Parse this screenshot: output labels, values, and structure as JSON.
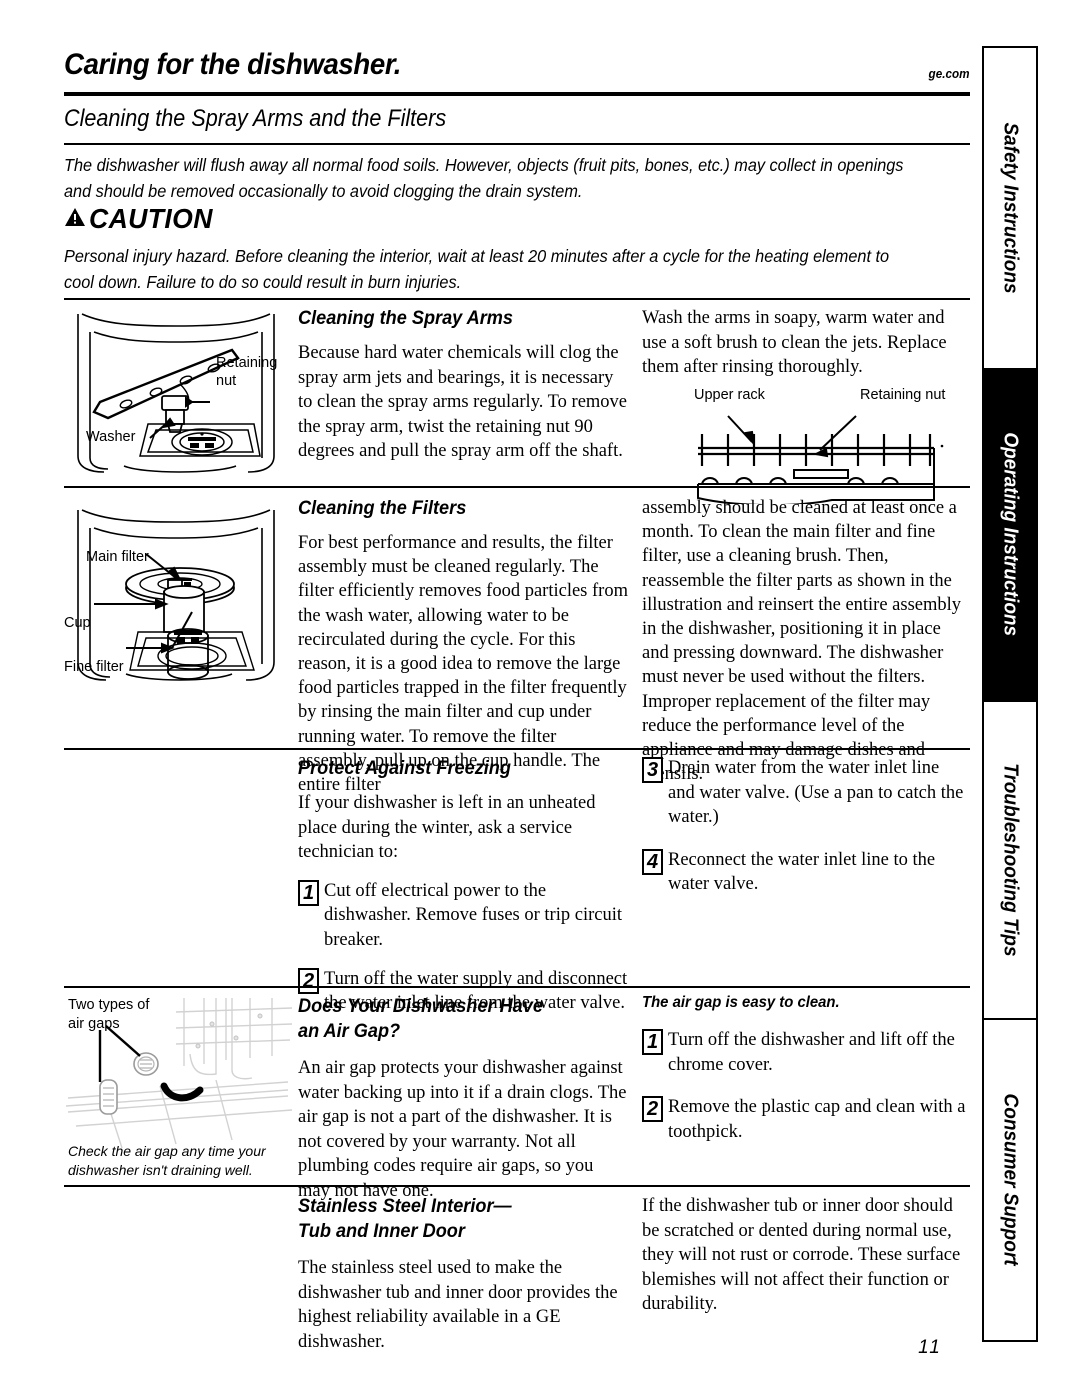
{
  "header": {
    "title": "Caring for the dishwasher.",
    "site": "ge.com",
    "subtitle": "Cleaning the Spray Arms and the Filters",
    "intro": "The dishwasher will flush away all normal food soils. However, objects (fruit pits, bones, etc.) may collect in openings and should be removed occasionally to avoid clogging the drain system."
  },
  "caution": {
    "word": "CAUTION",
    "icon": "warning-triangle-icon",
    "body": "Personal injury hazard. Before cleaning the interior, wait at least 20 minutes after a cycle for the heating element to cool down. Failure to do so could result in burn injuries."
  },
  "spray_arms": {
    "heading": "Cleaning the Spray Arms",
    "left_text": "Because hard water chemicals will clog the spray arm jets and bearings, it is necessary to clean the spray arms regularly. To remove the spray arm, twist the retaining nut 90 degrees and pull the spray arm off the shaft.",
    "right_text": "Wash the arms in soapy, warm water and use a soft brush to clean the jets. Replace them after rinsing thoroughly.",
    "fig_left_labels": {
      "retaining_nut": "Retaining\nnut",
      "washer": "Washer"
    },
    "fig_right_labels": {
      "upper_rack": "Upper rack",
      "retaining_nut": "Retaining nut"
    }
  },
  "filters": {
    "heading": "Cleaning the Filters",
    "left_text": "For best performance and results, the filter assembly must be cleaned regularly. The filter efficiently removes food particles from the wash water, allowing water to be recirculated during the cycle. For this reason, it is a good idea to remove the large food particles trapped in the filter frequently by rinsing the main filter and cup under running water. To remove the filter assembly, pull up on the cup handle. The entire filter",
    "right_text": "assembly should be cleaned at least once a month. To clean the main filter and fine filter, use a cleaning brush. Then, reassemble the filter parts as shown in the illustration and reinsert the entire assembly in the dishwasher, positioning it in place and pressing downward. The dishwasher must never be used without the filters. Improper replacement of the filter may reduce the performance level of the appliance and may damage dishes and utensils.",
    "fig_labels": {
      "main_filter": "Main filter",
      "cup": "Cup",
      "fine_filter": "Fine filter"
    }
  },
  "freezing": {
    "heading": "Protect Against Freezing",
    "intro": "If your dishwasher is left in an unheated place during the winter, ask a service technician to:",
    "steps": [
      {
        "n": "1",
        "text": "Cut off electrical power to the dishwasher. Remove fuses or trip circuit breaker."
      },
      {
        "n": "2",
        "text": "Turn off the water supply and disconnect the water inlet line from the water valve."
      },
      {
        "n": "3",
        "text": "Drain water from the water inlet line and water valve. (Use a pan to catch the water.)"
      },
      {
        "n": "4",
        "text": "Reconnect the water inlet line to the water valve."
      }
    ]
  },
  "air_gap": {
    "heading_line1": "Does Your Dishwasher Have",
    "heading_line2": "an Air Gap?",
    "body": "An air gap protects your dishwasher against water backing up into it if a drain clogs. The air gap is not a part of the dishwasher. It is not covered by your warranty. Not all plumbing codes require air gaps, so you may not have one.",
    "fig_label": "Two types of\nair gaps",
    "fig_caption": "Check the air gap any time your dishwasher isn't draining well.",
    "clean_heading": "The air gap is easy to clean.",
    "clean_steps": [
      {
        "n": "1",
        "text": "Turn off the dishwasher and lift off the chrome cover."
      },
      {
        "n": "2",
        "text": "Remove the plastic cap and clean with a toothpick."
      }
    ]
  },
  "stainless": {
    "heading_line1": "Stainless Steel Interior—",
    "heading_line2": "Tub and Inner Door",
    "left_text": "The stainless steel used to make the dishwasher tub and inner door provides the highest reliability available in a GE dishwasher.",
    "right_text": "If the dishwasher tub or inner door should be scratched or dented during normal use, they will not rust or corrode. These surface blemishes will not affect their function or durability."
  },
  "rail": {
    "tabs": [
      {
        "label": "Safety Instructions",
        "active": false
      },
      {
        "label": "Operating Instructions",
        "active": true
      },
      {
        "label": "Troubleshooting Tips",
        "active": false
      },
      {
        "label": "Consumer Support",
        "active": false
      }
    ]
  },
  "page_number": "11"
}
